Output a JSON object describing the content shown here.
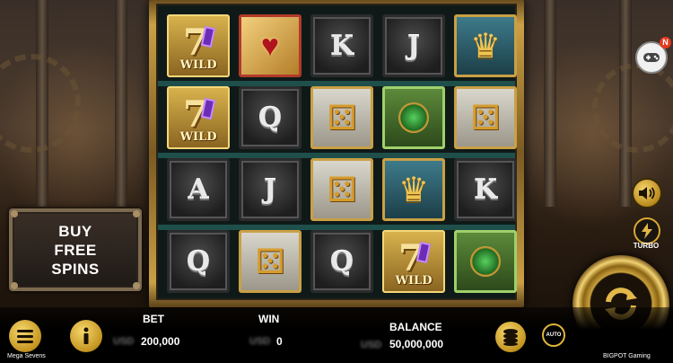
{
  "game": {
    "name": "Mega Sevens",
    "brand": "BIGPOT Gaming"
  },
  "buy_free_spins": {
    "line1": "BUY",
    "line2": "FREE",
    "line3": "SPINS"
  },
  "reels": [
    [
      "wild",
      "heart",
      "K",
      "J",
      "crown"
    ],
    [
      "wild",
      "Q",
      "dice",
      "emerald",
      "dice"
    ],
    [
      "A",
      "J",
      "dice",
      "crown",
      "K"
    ],
    [
      "Q",
      "dice",
      "Q",
      "wild",
      "emerald"
    ]
  ],
  "wild_text": "WILD",
  "controls": {
    "notification_badge": "N",
    "turbo_label": "TURBO",
    "auto_label": "AUTO"
  },
  "bottom_bar": {
    "bet_label": "BET",
    "bet_value": "200,000",
    "win_label": "WIN",
    "win_value": "0",
    "balance_label": "BALANCE",
    "balance_value": "50,000,000",
    "currency_blurred": "USD"
  },
  "icons": {
    "menu": "menu-icon",
    "info": "info-icon",
    "sound": "speaker-icon",
    "turbo": "lightning-icon",
    "spin": "refresh-arrows-icon",
    "stake": "coin-stack-icon",
    "auto": "auto-icon",
    "gamepad": "gamepad-icon"
  },
  "colors": {
    "gold": "#d9a82f",
    "frame": "#caa045",
    "background": "#120d08"
  }
}
